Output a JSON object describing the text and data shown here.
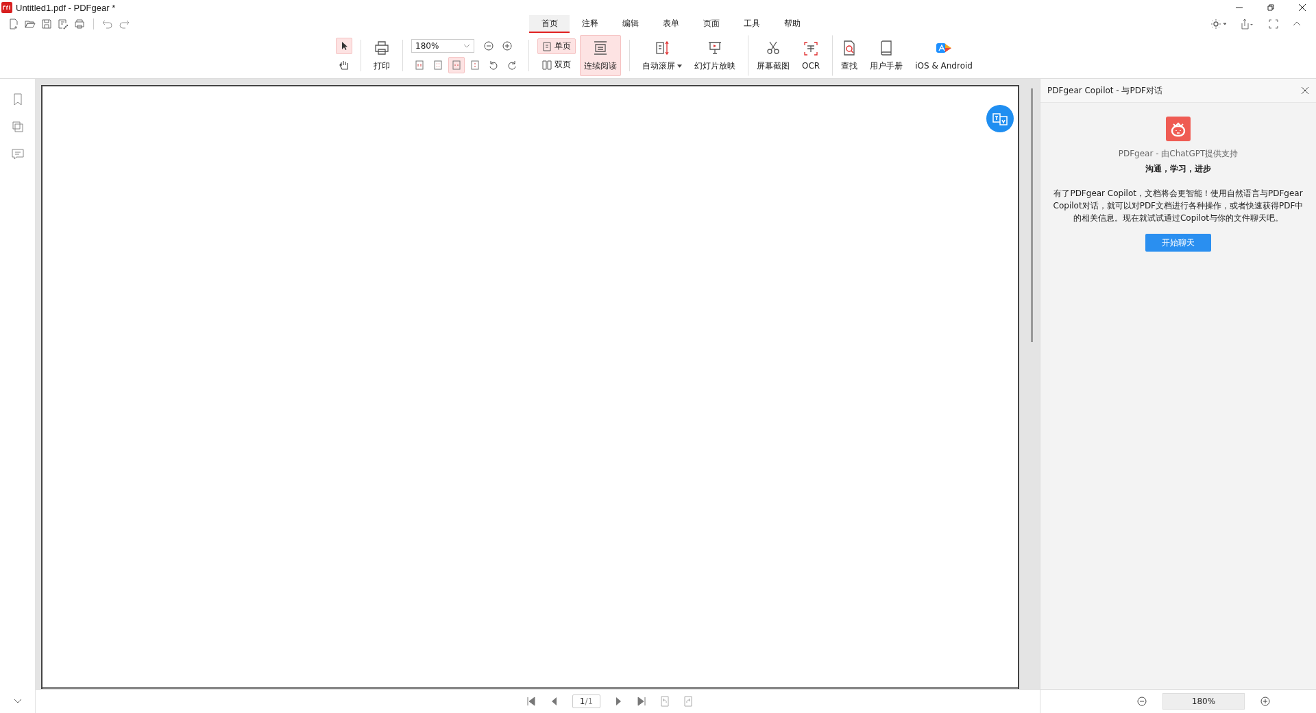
{
  "window": {
    "title": "Untitled1.pdf - PDFgear *"
  },
  "menu_tabs": [
    {
      "label": "首页",
      "selected": true
    },
    {
      "label": "注释",
      "selected": false
    },
    {
      "label": "编辑",
      "selected": false
    },
    {
      "label": "表单",
      "selected": false
    },
    {
      "label": "页面",
      "selected": false
    },
    {
      "label": "工具",
      "selected": false
    },
    {
      "label": "帮助",
      "selected": false
    }
  ],
  "ribbon": {
    "pointer_tools": [
      {
        "selected": true
      },
      {
        "selected": false
      }
    ],
    "print": {
      "label": "打印"
    },
    "zoom": {
      "value": "180%"
    },
    "fit_tools": [
      {
        "selected": false
      },
      {
        "selected": false
      },
      {
        "selected": true
      },
      {
        "selected": false
      }
    ],
    "layout": [
      {
        "label": "单页",
        "selected": true
      },
      {
        "label": "双页",
        "selected": false
      }
    ],
    "continuous": {
      "label": "连续阅读",
      "selected": true
    },
    "buttons": [
      {
        "label": "自动滚屏",
        "dropdown": true,
        "separator_before": false
      },
      {
        "label": "幻灯片放映",
        "dropdown": false,
        "separator_before": false
      },
      {
        "label": "屏幕截图",
        "dropdown": false,
        "separator_before": true
      },
      {
        "label": "OCR",
        "dropdown": false,
        "separator_before": false
      },
      {
        "label": "查找",
        "dropdown": false,
        "separator_before": true
      },
      {
        "label": "用户手册",
        "dropdown": false,
        "separator_before": false
      },
      {
        "label": "iOS & Android",
        "dropdown": false,
        "separator_before": false
      }
    ]
  },
  "copilot": {
    "title": "PDFgear Copilot - 与PDF对话",
    "subtitle": "PDFgear - 由ChatGPT提供支持",
    "tagline": "沟通，学习，进步",
    "description": "有了PDFgear Copilot，文档将会更智能！使用自然语言与PDFgear Copilot对话，就可以对PDF文档进行各种操作，或者快速获得PDF中的相关信息。现在就试试通过Copilot与你的文件聊天吧。",
    "button": "开始聊天"
  },
  "status_bar": {
    "page": "1",
    "page_total": "/1",
    "zoom": "180%"
  }
}
